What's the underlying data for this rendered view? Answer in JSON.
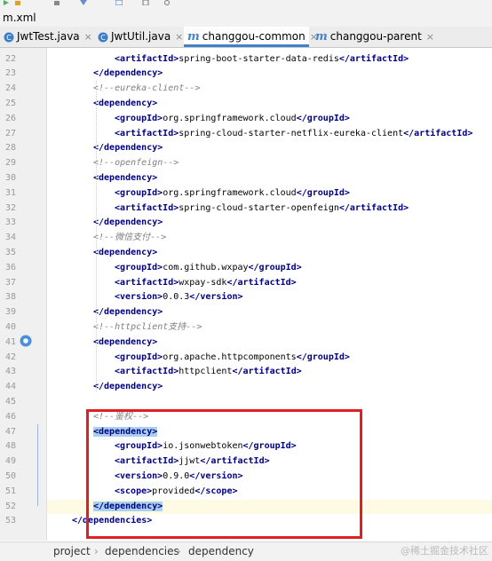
{
  "file_title": "m.xml",
  "tabs": [
    {
      "label": "JwtTest.java",
      "icon": "java-class-icon",
      "active": false
    },
    {
      "label": "JwtUtil.java",
      "icon": "java-class-icon",
      "active": false
    },
    {
      "label": "changgou-common",
      "icon": "maven-icon",
      "active": true
    },
    {
      "label": "changgou-parent",
      "icon": "maven-icon",
      "active": false
    }
  ],
  "editor": {
    "lines": [
      {
        "n": "22",
        "indent": 3,
        "parts": [
          [
            "tag",
            "<artifactId>"
          ],
          [
            "txt",
            "spring-boot-starter-data-redis"
          ],
          [
            "tag",
            "</artifactId>"
          ]
        ]
      },
      {
        "n": "23",
        "indent": 2,
        "parts": [
          [
            "tag",
            "</dependency>"
          ]
        ]
      },
      {
        "n": "24",
        "indent": 2,
        "parts": [
          [
            "cmt",
            "<!--eureka-client-->"
          ]
        ]
      },
      {
        "n": "25",
        "indent": 2,
        "parts": [
          [
            "tag",
            "<dependency>"
          ]
        ]
      },
      {
        "n": "26",
        "indent": 3,
        "parts": [
          [
            "tag",
            "<groupId>"
          ],
          [
            "txt",
            "org.springframework.cloud"
          ],
          [
            "tag",
            "</groupId>"
          ]
        ]
      },
      {
        "n": "27",
        "indent": 3,
        "parts": [
          [
            "tag",
            "<artifactId>"
          ],
          [
            "txt",
            "spring-cloud-starter-netflix-eureka-client"
          ],
          [
            "tag",
            "</artifactId>"
          ]
        ]
      },
      {
        "n": "28",
        "indent": 2,
        "parts": [
          [
            "tag",
            "</dependency>"
          ]
        ]
      },
      {
        "n": "29",
        "indent": 2,
        "parts": [
          [
            "cmt",
            "<!--openfeign-->"
          ]
        ]
      },
      {
        "n": "30",
        "indent": 2,
        "parts": [
          [
            "tag",
            "<dependency>"
          ]
        ]
      },
      {
        "n": "31",
        "indent": 3,
        "parts": [
          [
            "tag",
            "<groupId>"
          ],
          [
            "txt",
            "org.springframework.cloud"
          ],
          [
            "tag",
            "</groupId>"
          ]
        ]
      },
      {
        "n": "32",
        "indent": 3,
        "parts": [
          [
            "tag",
            "<artifactId>"
          ],
          [
            "txt",
            "spring-cloud-starter-openfeign"
          ],
          [
            "tag",
            "</artifactId>"
          ]
        ]
      },
      {
        "n": "33",
        "indent": 2,
        "parts": [
          [
            "tag",
            "</dependency>"
          ]
        ]
      },
      {
        "n": "34",
        "indent": 2,
        "parts": [
          [
            "cmt",
            "<!--微信支付-->"
          ]
        ]
      },
      {
        "n": "35",
        "indent": 2,
        "parts": [
          [
            "tag",
            "<dependency>"
          ]
        ]
      },
      {
        "n": "36",
        "indent": 3,
        "parts": [
          [
            "tag",
            "<groupId>"
          ],
          [
            "txt",
            "com.github.wxpay"
          ],
          [
            "tag",
            "</groupId>"
          ]
        ]
      },
      {
        "n": "37",
        "indent": 3,
        "parts": [
          [
            "tag",
            "<artifactId>"
          ],
          [
            "txt",
            "wxpay-sdk"
          ],
          [
            "tag",
            "</artifactId>"
          ]
        ]
      },
      {
        "n": "38",
        "indent": 3,
        "parts": [
          [
            "tag",
            "<version>"
          ],
          [
            "txt",
            "0.0.3"
          ],
          [
            "tag",
            "</version>"
          ]
        ]
      },
      {
        "n": "39",
        "indent": 2,
        "parts": [
          [
            "tag",
            "</dependency>"
          ]
        ]
      },
      {
        "n": "40",
        "indent": 2,
        "parts": [
          [
            "cmt",
            "<!--httpclient支持-->"
          ]
        ]
      },
      {
        "n": "41",
        "indent": 2,
        "parts": [
          [
            "tag",
            "<dependency>"
          ]
        ]
      },
      {
        "n": "42",
        "indent": 3,
        "parts": [
          [
            "tag",
            "<groupId>"
          ],
          [
            "txt",
            "org.apache.httpcomponents"
          ],
          [
            "tag",
            "</groupId>"
          ]
        ]
      },
      {
        "n": "43",
        "indent": 3,
        "parts": [
          [
            "tag",
            "<artifactId>"
          ],
          [
            "txt",
            "httpclient"
          ],
          [
            "tag",
            "</artifactId>"
          ]
        ]
      },
      {
        "n": "44",
        "indent": 2,
        "parts": [
          [
            "tag",
            "</dependency>"
          ]
        ]
      },
      {
        "n": "45",
        "indent": 0,
        "parts": []
      },
      {
        "n": "46",
        "indent": 2,
        "parts": [
          [
            "cmt",
            "<!--鉴权-->"
          ]
        ]
      },
      {
        "n": "47",
        "indent": 2,
        "parts": [
          [
            "taghl",
            "<dependency>"
          ]
        ]
      },
      {
        "n": "48",
        "indent": 3,
        "parts": [
          [
            "tag",
            "<groupId>"
          ],
          [
            "txt",
            "io.jsonwebtoken"
          ],
          [
            "tag",
            "</groupId>"
          ]
        ]
      },
      {
        "n": "49",
        "indent": 3,
        "parts": [
          [
            "tag",
            "<artifactId>"
          ],
          [
            "txt",
            "jjwt"
          ],
          [
            "tag",
            "</artifactId>"
          ]
        ]
      },
      {
        "n": "50",
        "indent": 3,
        "parts": [
          [
            "tag",
            "<version>"
          ],
          [
            "txt",
            "0.9.0"
          ],
          [
            "tag",
            "</version>"
          ]
        ]
      },
      {
        "n": "51",
        "indent": 3,
        "parts": [
          [
            "tag",
            "<scope>"
          ],
          [
            "txt",
            "provided"
          ],
          [
            "tag",
            "</scope>"
          ]
        ]
      },
      {
        "n": "52",
        "indent": 2,
        "parts": [
          [
            "taghl",
            "</dependency>"
          ]
        ],
        "current": true
      },
      {
        "n": "53",
        "indent": 1,
        "parts": [
          [
            "tag",
            "</dependencies>"
          ]
        ]
      }
    ]
  },
  "breadcrumb": [
    "project",
    "dependencies",
    "dependency"
  ],
  "watermark": "@稀土掘金技术社区",
  "colors": {
    "tag": "#000080",
    "comment": "#808080",
    "highlight_box": "#e02020",
    "active_tab_underline": "#4083c9"
  }
}
